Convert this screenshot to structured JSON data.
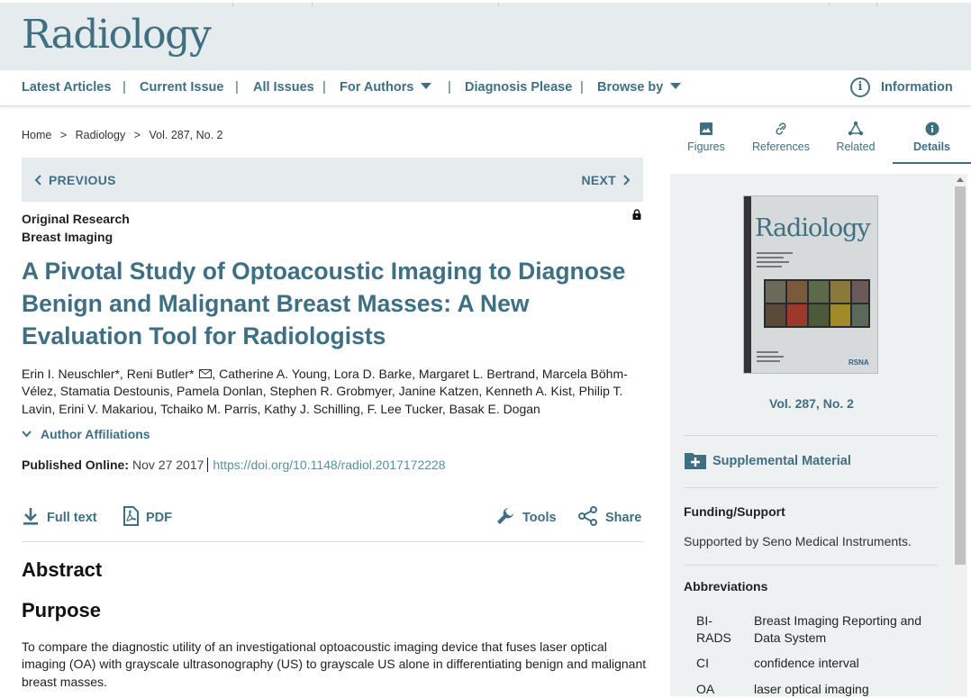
{
  "site": {
    "logo": "Radiology"
  },
  "nav": {
    "latest": "Latest Articles",
    "current": "Current Issue",
    "all": "All Issues",
    "authors": "For Authors",
    "diagnosis": "Diagnosis Please",
    "browse": "Browse by",
    "info": "Information",
    "separator": "|"
  },
  "breadcrumb": {
    "home": "Home",
    "sep": ">",
    "journal": "Radiology",
    "issue": "Vol. 287, No. 2"
  },
  "pager": {
    "prev": "PREVIOUS",
    "next": "NEXT"
  },
  "article": {
    "type": "Original Research",
    "section": "Breast Imaging",
    "title": "A Pivotal Study of Optoacoustic Imaging to Diagnose Benign and Malignant Breast Masses: A New Evaluation Tool for Radiologists",
    "authors_a": "Erin I. Neuschler*, Reni Butler*",
    "authors_b": ", Catherine A. Young, Lora D. Barke, Margaret L. Bertrand, Marcela Böhm-Vélez, Stamatia Destounis, Pamela Donlan, Stephen R. Grobmyer, Janine Katzen, Kenneth A. Kist, Philip T. Lavin, Erini V. Makariou, Tchaiko M. Parris, Kathy J. Schilling, F. Lee Tucker, Basak E. Dogan",
    "affiliations": "Author Affiliations",
    "published_label": "Published Online:",
    "published_date": "Nov 27 2017",
    "doi": "https://doi.org/10.1148/radiol.2017172228"
  },
  "actions": {
    "fulltext": "Full text",
    "pdf": "PDF",
    "tools": "Tools",
    "share": "Share"
  },
  "abstract": {
    "heading": "Abstract",
    "purpose_heading": "Purpose",
    "purpose_text": "To compare the diagnostic utility of an investigational optoacoustic imaging device that fuses laser optical imaging (OA) with grayscale ultrasonography (US) to grayscale US alone in differentiating benign and malignant breast masses."
  },
  "tabs": {
    "figures": "Figures",
    "references": "References",
    "related": "Related",
    "details": "Details"
  },
  "sidebar": {
    "cover_title": "Radiology",
    "cover_publisher": "RSNA",
    "volume": "Vol. 287, No. 2",
    "supplemental": "Supplemental Material",
    "funding_heading": "Funding/Support",
    "funding_text": "Supported by Seno Medical Instruments.",
    "abbr_heading": "Abbreviations",
    "abbreviations": [
      {
        "key": "BI-RADS",
        "value": "Breast Imaging Reporting and Data System"
      },
      {
        "key": "CI",
        "value": "confidence interval"
      },
      {
        "key": "OA",
        "value": "laser optical imaging"
      }
    ]
  },
  "colors": {
    "accent": "#3f6f82",
    "header_bg": "#e6ecee",
    "panel_bg": "#eef1f2",
    "link": "#5a8fa3"
  }
}
